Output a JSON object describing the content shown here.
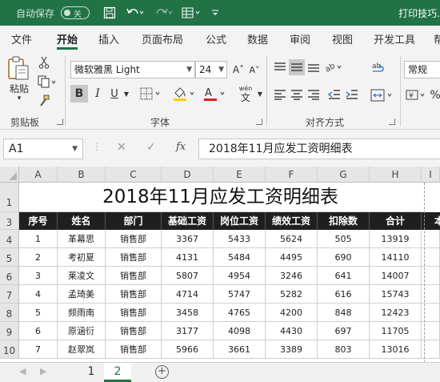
{
  "titlebar": {
    "autosave_label": "自动保存",
    "autosave_state": "关",
    "doc_title": "打印技巧.",
    "icons": [
      "save-icon",
      "undo-icon",
      "redo-icon",
      "form-icon",
      "customize-icon"
    ]
  },
  "tabs": [
    "文件",
    "开始",
    "插入",
    "页面布局",
    "公式",
    "数据",
    "审阅",
    "视图",
    "开发工具",
    "帮"
  ],
  "active_tab": "开始",
  "ribbon": {
    "clipboard": {
      "paste_label": "粘贴",
      "group_label": "剪贴板"
    },
    "font": {
      "font_name": "微软雅黑 Light",
      "font_size": "24",
      "grow_label": "A˄",
      "shrink_label": "A˅",
      "bold": "B",
      "italic": "I",
      "underline": "U",
      "wen_label": "wén",
      "wen_char": "文",
      "group_label": "字体"
    },
    "alignment": {
      "group_label": "对齐方式"
    },
    "number": {
      "format": "常规"
    }
  },
  "formula_bar": {
    "name_box": "A1",
    "cancel": "✕",
    "enter": "✓",
    "fx": "fx",
    "formula": "2018年11月应发工资明细表"
  },
  "grid": {
    "columns": [
      "A",
      "B",
      "C",
      "D",
      "E",
      "F",
      "G",
      "H",
      "I"
    ],
    "row_numbers": [
      "1",
      "3",
      "4",
      "5",
      "6",
      "7",
      "8",
      "9",
      "10"
    ],
    "title": "2018年11月应发工资明细表",
    "headers": [
      "序号",
      "姓名",
      "部门",
      "基础工资",
      "岗位工资",
      "绩效工资",
      "扣除数",
      "合计",
      "本"
    ],
    "rows": [
      [
        "1",
        "革幕思",
        "销售部",
        "3367",
        "5433",
        "5624",
        "505",
        "13919"
      ],
      [
        "2",
        "考初夏",
        "销售部",
        "4131",
        "5484",
        "4495",
        "690",
        "14110"
      ],
      [
        "3",
        "莱凌文",
        "销售部",
        "5807",
        "4954",
        "3246",
        "641",
        "14007"
      ],
      [
        "4",
        "孟琦美",
        "销售部",
        "4714",
        "5747",
        "5282",
        "616",
        "15743"
      ],
      [
        "5",
        "频雨南",
        "销售部",
        "3458",
        "4765",
        "4200",
        "848",
        "12423"
      ],
      [
        "6",
        "原涵衍",
        "销售部",
        "3177",
        "4098",
        "4430",
        "697",
        "11705"
      ],
      [
        "7",
        "赵翠岚",
        "销售部",
        "5966",
        "3661",
        "3389",
        "803",
        "13016"
      ]
    ]
  },
  "sheets": [
    "1",
    "2"
  ],
  "active_sheet": "2"
}
